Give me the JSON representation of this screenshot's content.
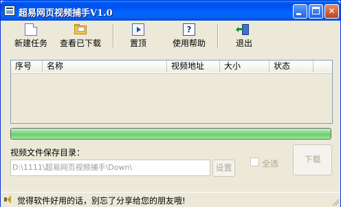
{
  "window": {
    "title": "超易网页视频捕手V1.0",
    "controls": {
      "minimize": "",
      "maximize": "",
      "close": "✕"
    }
  },
  "toolbar": {
    "items": [
      {
        "label": "新建任务",
        "icon": "new-document-icon"
      },
      {
        "label": "查看已下载",
        "icon": "open-folder-icon"
      },
      {
        "label": "置顶",
        "icon": "pin-top-icon"
      },
      {
        "label": "使用帮助",
        "icon": "help-icon"
      },
      {
        "label": "退出",
        "icon": "exit-door-icon"
      }
    ]
  },
  "list": {
    "columns": [
      "序号",
      "名称",
      "视频地址",
      "大小",
      "状态"
    ],
    "rows": []
  },
  "progress": {
    "fraction": 1.0
  },
  "save": {
    "label": "视频文件保存目录：",
    "path": "D:\\1111\\超易网页视频捕手\\Down\\",
    "set_button": "设置"
  },
  "select_all_label": "全选",
  "download_button": "下载",
  "status": {
    "text": "觉得软件好用的话，别忘了分享给您的朋友哦!",
    "icon": "speaker-icon"
  },
  "colors": {
    "titlebar": "#0054e3",
    "progress": "#6ad06a",
    "face": "#ece9d8"
  }
}
